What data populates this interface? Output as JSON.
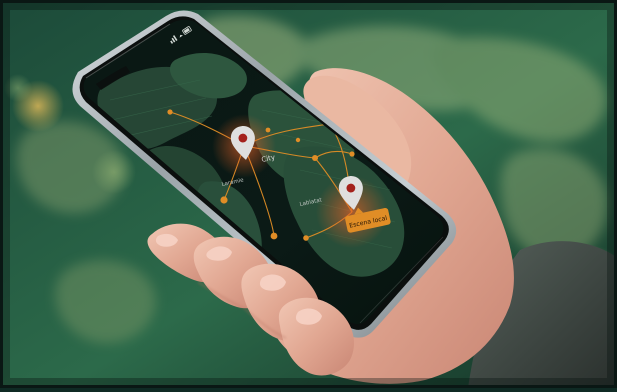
{
  "map_screen": {
    "labels": {
      "city": "City",
      "region_left": "Laramie",
      "region_center": "Lablatat"
    },
    "callout": {
      "text": "Escena local"
    }
  },
  "colors": {
    "background_green": "#2c6a4a",
    "map_land": "#2f5a41",
    "screen_dark": "#0b1a15",
    "route_orange": "#f39a2a",
    "pin_white": "#f2f2f2",
    "pin_red": "#b2241f",
    "phone_frame": "#b9c1c5"
  },
  "icons": {
    "status_bar_right": [
      "signal-icon",
      "wifi-icon",
      "battery-icon"
    ],
    "map_pins": [
      "map-pin-icon",
      "map-pin-icon"
    ]
  }
}
